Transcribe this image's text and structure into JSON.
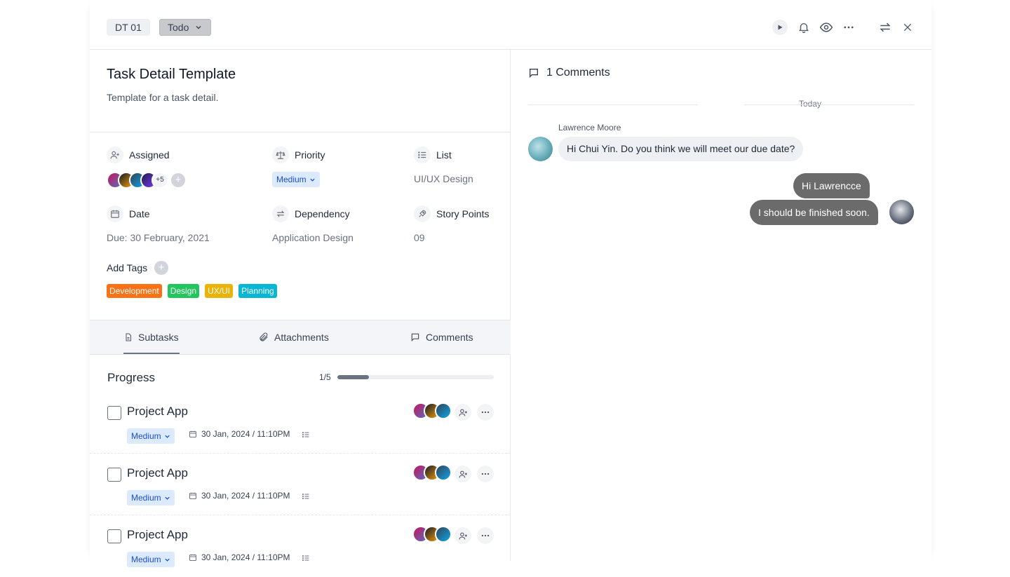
{
  "header": {
    "task_id": "DT 01",
    "status": "Todo"
  },
  "task": {
    "title": "Task Detail Template",
    "description": "Template for a task detail."
  },
  "fields": {
    "assigned_label": "Assigned",
    "assigned_more": "+5",
    "priority_label": "Priority",
    "priority_value": "Medium",
    "list_label": "List",
    "list_value": "UI/UX Design",
    "date_label": "Date",
    "date_value": "Due: 30 February, 2021",
    "dependency_label": "Dependency",
    "dependency_value": "Application Design",
    "story_points_label": "Story Points",
    "story_points_value": "09",
    "tags_label": "Add Tags"
  },
  "tags": [
    {
      "label": "Development",
      "color": "#f97316"
    },
    {
      "label": "Design",
      "color": "#22c55e"
    },
    {
      "label": "UX/UI",
      "color": "#eab308"
    },
    {
      "label": "Planning",
      "color": "#06b6d4"
    }
  ],
  "tabs": [
    {
      "label": "Subtasks",
      "icon": "file-icon",
      "active": true
    },
    {
      "label": "Attachments",
      "icon": "paperclip-icon",
      "active": false
    },
    {
      "label": "Comments",
      "icon": "comment-icon",
      "active": false
    }
  ],
  "progress": {
    "label": "Progress",
    "count": "1/5",
    "fraction": 0.2
  },
  "subtasks": [
    {
      "title": "Project App",
      "priority": "Medium",
      "date": "30 Jan, 2024 / 11:10PM"
    },
    {
      "title": "Project App",
      "priority": "Medium",
      "date": "30 Jan, 2024 / 11:10PM"
    },
    {
      "title": "Project App",
      "priority": "Medium",
      "date": "30 Jan, 2024 / 11:10PM"
    }
  ],
  "comments": {
    "heading": "1 Comments",
    "day": "Today",
    "author": "Lawrence Moore",
    "incoming": "Hi Chui Yin. Do you think we will meet our due date?",
    "outgoing_1": "Hi Lawrencce",
    "outgoing_2": "I should be finished soon."
  },
  "colors": {
    "accent_blue": "#1d4ed8",
    "pill_bg": "#dbeafe",
    "bubble_out": "#6b6b6b",
    "bubble_in": "#eef0f3"
  }
}
